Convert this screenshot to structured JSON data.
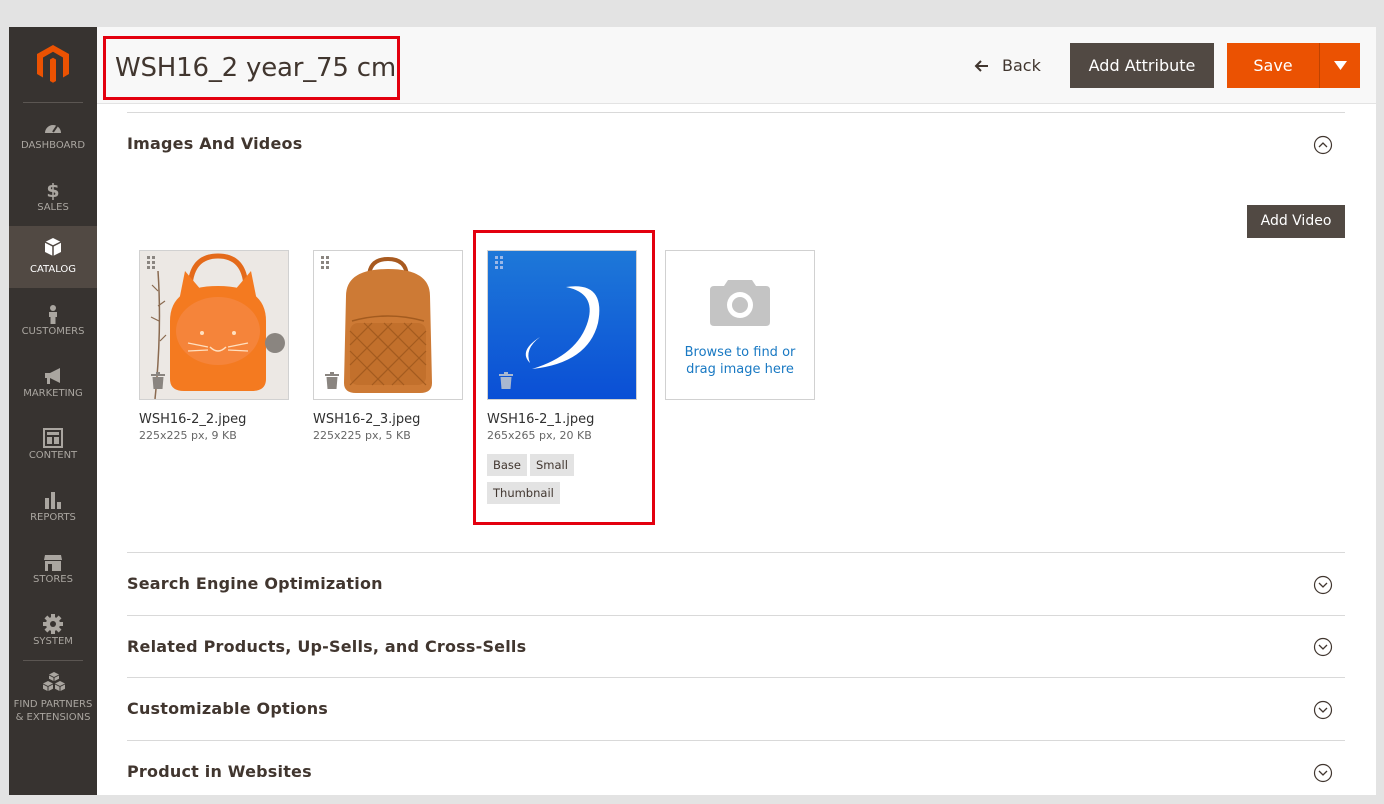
{
  "header": {
    "title": "WSH16_2 year_75 cm",
    "back_label": "Back",
    "add_attribute_label": "Add Attribute",
    "save_label": "Save"
  },
  "sidebar": {
    "items": [
      {
        "label": "DASHBOARD",
        "icon": "dashboard-icon",
        "active": false
      },
      {
        "label": "SALES",
        "icon": "dollar-icon",
        "active": false
      },
      {
        "label": "CATALOG",
        "icon": "box-icon",
        "active": true
      },
      {
        "label": "CUSTOMERS",
        "icon": "person-icon",
        "active": false
      },
      {
        "label": "MARKETING",
        "icon": "megaphone-icon",
        "active": false
      },
      {
        "label": "CONTENT",
        "icon": "layout-icon",
        "active": false
      },
      {
        "label": "REPORTS",
        "icon": "bar-chart-icon",
        "active": false
      },
      {
        "label": "STORES",
        "icon": "storefront-icon",
        "active": false
      },
      {
        "label": "SYSTEM",
        "icon": "gear-icon",
        "active": false
      },
      {
        "label_line1": "FIND PARTNERS",
        "label_line2": "& EXTENSIONS",
        "icon": "cubes-icon",
        "active": false
      }
    ]
  },
  "images_section": {
    "title": "Images And Videos",
    "add_video_label": "Add Video",
    "images": [
      {
        "file": "WSH16-2_2.jpeg",
        "meta": "225x225 px, 9 KB"
      },
      {
        "file": "WSH16-2_3.jpeg",
        "meta": "225x225 px, 5 KB"
      },
      {
        "file": "WSH16-2_1.jpeg",
        "meta": "265x265 px, 20 KB",
        "roles": [
          "Base",
          "Small",
          "Thumbnail"
        ]
      }
    ],
    "upload_line1": "Browse to find or",
    "upload_line2": "drag image here"
  },
  "sections": [
    {
      "title": "Search Engine Optimization"
    },
    {
      "title": "Related Products, Up-Sells, and Cross-Sells"
    },
    {
      "title": "Customizable Options"
    },
    {
      "title": "Product in Websites"
    }
  ],
  "colors": {
    "sidebar_bg": "#373330",
    "sidebar_active": "#514943",
    "save_orange": "#eb5202",
    "dark_button": "#514943",
    "highlight_red": "#e3000f",
    "link_blue": "#1979c3"
  }
}
